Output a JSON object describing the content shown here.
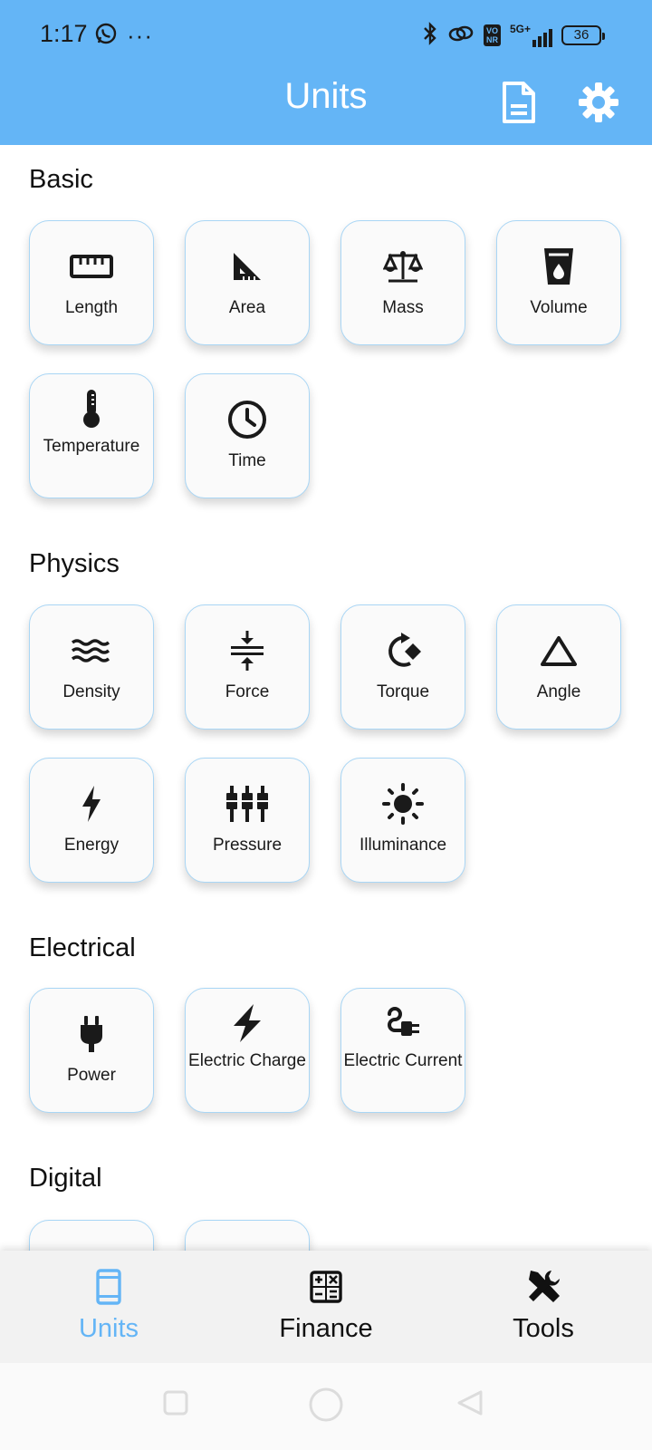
{
  "status_bar": {
    "time": "1:17",
    "dots": "···",
    "volte_tag": "Vo\nNR",
    "network": "5G+",
    "battery": "36"
  },
  "header": {
    "title": "Units",
    "doc_icon": "document-icon",
    "settings_icon": "gear-icon"
  },
  "sections": {
    "basic": {
      "title": "Basic",
      "items": [
        {
          "label": "Length",
          "icon": "ruler-icon"
        },
        {
          "label": "Area",
          "icon": "set-square-icon"
        },
        {
          "label": "Mass",
          "icon": "scale-icon"
        },
        {
          "label": "Volume",
          "icon": "cup-icon"
        },
        {
          "label": "Temperature",
          "icon": "thermometer-icon"
        },
        {
          "label": "Time",
          "icon": "clock-icon"
        }
      ]
    },
    "physics": {
      "title": "Physics",
      "items": [
        {
          "label": "Density",
          "icon": "waves-icon"
        },
        {
          "label": "Force",
          "icon": "compress-icon"
        },
        {
          "label": "Torque",
          "icon": "rotate-icon"
        },
        {
          "label": "Angle",
          "icon": "triangle-icon"
        },
        {
          "label": "Energy",
          "icon": "bolt-icon"
        },
        {
          "label": "Pressure",
          "icon": "pistons-icon"
        },
        {
          "label": "Illuminance",
          "icon": "sun-icon"
        }
      ]
    },
    "electrical": {
      "title": "Electrical",
      "items": [
        {
          "label": "Power",
          "icon": "plug-icon"
        },
        {
          "label": "Electric Charge",
          "icon": "flash-icon"
        },
        {
          "label": "Electric Current",
          "icon": "cable-icon"
        }
      ]
    },
    "digital": {
      "title": "Digital"
    }
  },
  "bottom_nav": {
    "items": [
      {
        "label": "Units",
        "icon": "phone-icon",
        "active": true
      },
      {
        "label": "Finance",
        "icon": "calculator-icon",
        "active": false
      },
      {
        "label": "Tools",
        "icon": "tools-icon",
        "active": false
      }
    ]
  },
  "colors": {
    "accent": "#64b5f6",
    "tile_border": "#a9d6f5",
    "nav_background": "#f2f2f2"
  }
}
